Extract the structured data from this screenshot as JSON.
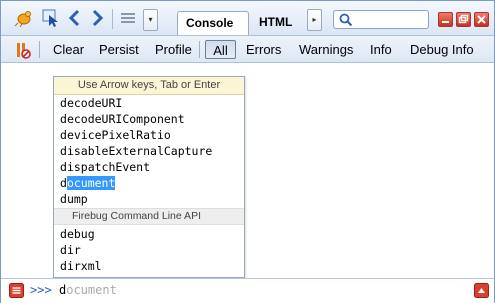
{
  "toolbar": {
    "tabs": [
      {
        "label": "Console",
        "active": true
      },
      {
        "label": "HTML",
        "active": false
      }
    ],
    "search": {
      "placeholder": "",
      "value": ""
    },
    "icons": [
      "firebug-icon",
      "inspect-icon",
      "back-icon",
      "forward-icon",
      "menu-icon",
      "dropdown-icon",
      "scroll-right-icon",
      "search-icon",
      "minimize-icon",
      "detach-icon",
      "close-icon"
    ]
  },
  "filterbar": {
    "buttons": [
      "Clear",
      "Persist",
      "Profile"
    ],
    "filters": [
      "All",
      "Errors",
      "Warnings",
      "Info",
      "Debug Info"
    ],
    "selected": "All"
  },
  "autocomplete": {
    "hint": "Use Arrow keys, Tab or Enter",
    "typed_prefix": "d",
    "items": [
      {
        "rest": "ecodeURI",
        "selected": false
      },
      {
        "rest": "ecodeURIComponent",
        "selected": false
      },
      {
        "rest": "evicePixelRatio",
        "selected": false
      },
      {
        "rest": "isableExternalCapture",
        "selected": false
      },
      {
        "rest": "ispatchEvent",
        "selected": false
      },
      {
        "rest": "ocument",
        "selected": true
      },
      {
        "rest": "ump",
        "selected": false
      }
    ],
    "group_label": "Firebug Command Line API",
    "api_items": [
      {
        "rest": "ebug"
      },
      {
        "rest": "ir"
      },
      {
        "rest": "irxml"
      }
    ]
  },
  "commandline": {
    "prompt": ">>>",
    "typed": "d",
    "completion": "ocument"
  },
  "colors": {
    "selection": "#3399ff",
    "prompt": "#2b5cbd",
    "hint_bg": "#fbf5d6"
  }
}
